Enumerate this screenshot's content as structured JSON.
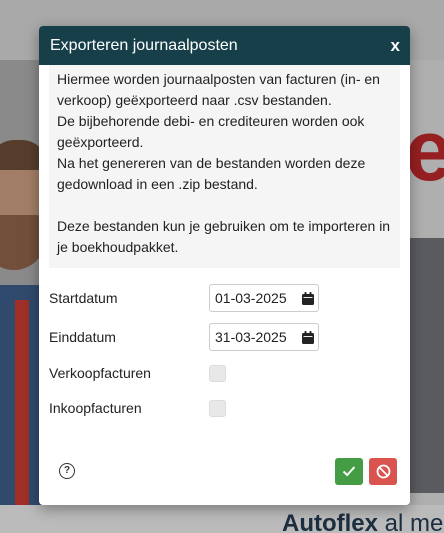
{
  "modal": {
    "title": "Exporteren journaalposten",
    "close_label": "x"
  },
  "info": {
    "line1": "Hiermee worden journaalposten van facturen (in- en verkoop) geëxporteerd naar .csv bestanden.",
    "line2": "De bijbehorende debi- en crediteuren worden ook geëxporteerd.",
    "line3": "Na het genereren van de bestanden worden deze gedownload in een .zip bestand.",
    "line4": "Deze bestanden kun je gebruiken om te importeren in je boekhoudpakket."
  },
  "form": {
    "start_label": "Startdatum",
    "start_value": "01-03-2025",
    "end_label": "Einddatum",
    "end_value": "31-03-2025",
    "sales_label": "Verkoopfacturen",
    "sales_checked": false,
    "purchase_label": "Inkoopfacturen",
    "purchase_checked": false
  },
  "background": {
    "brand_bold": "Autoflex",
    "brand_rest": " al me",
    "red_letter": "e"
  },
  "icons": {
    "calendar": "calendar-icon",
    "help": "question-circle-icon",
    "confirm": "check-icon",
    "cancel": "ban-icon"
  },
  "colors": {
    "header": "#163f4a",
    "confirm": "#449d44",
    "cancel": "#d9534f",
    "accent_red": "#b7262a"
  }
}
